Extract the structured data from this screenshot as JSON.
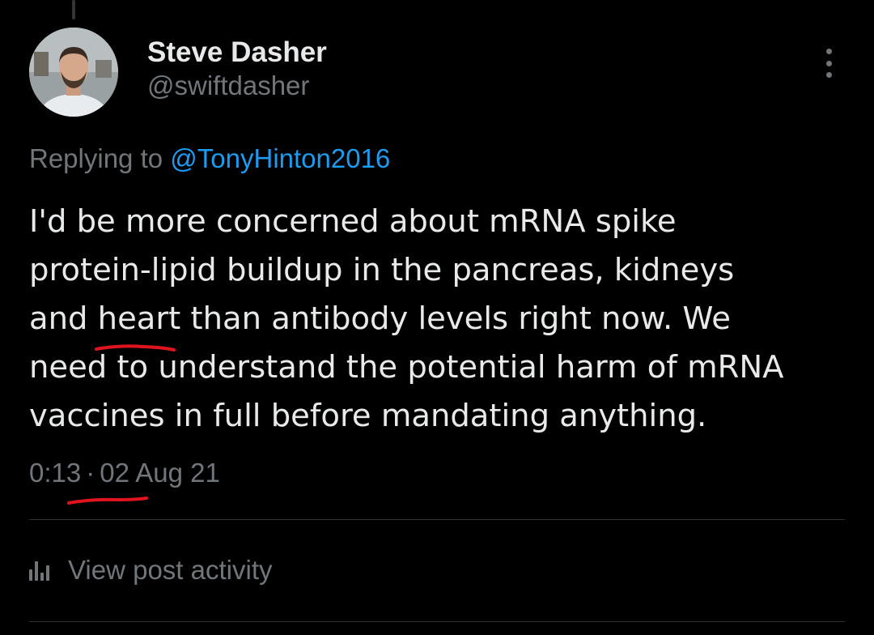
{
  "author": {
    "display_name": "Steve Dasher",
    "handle": "@swiftdasher",
    "avatar_icon": "profile-photo"
  },
  "reply": {
    "prefix": "Replying to",
    "mention": "@TonyHinton2016"
  },
  "tweet": {
    "line1": "I'd be more concerned about mRNA spike",
    "line2": "protein-lipid buildup in the pancreas, kidneys",
    "line3_before": "and ",
    "line3_highlight": "heart",
    "line3_after": " than antibody levels right now. We",
    "line4": "need to understand the potential harm of mRNA",
    "line5": "vaccines in full before mandating anything."
  },
  "meta": {
    "time": "0:13",
    "separator": "·",
    "date": "02 Aug 21"
  },
  "actions": {
    "view_activity": "View post activity",
    "activity_icon": "bar-chart-icon",
    "more_icon": "more-vertical-icon"
  },
  "colors": {
    "background": "#000000",
    "text": "#e7e9ea",
    "muted": "#71767b",
    "link": "#1d9bf0",
    "annotation": "#e0141e"
  }
}
